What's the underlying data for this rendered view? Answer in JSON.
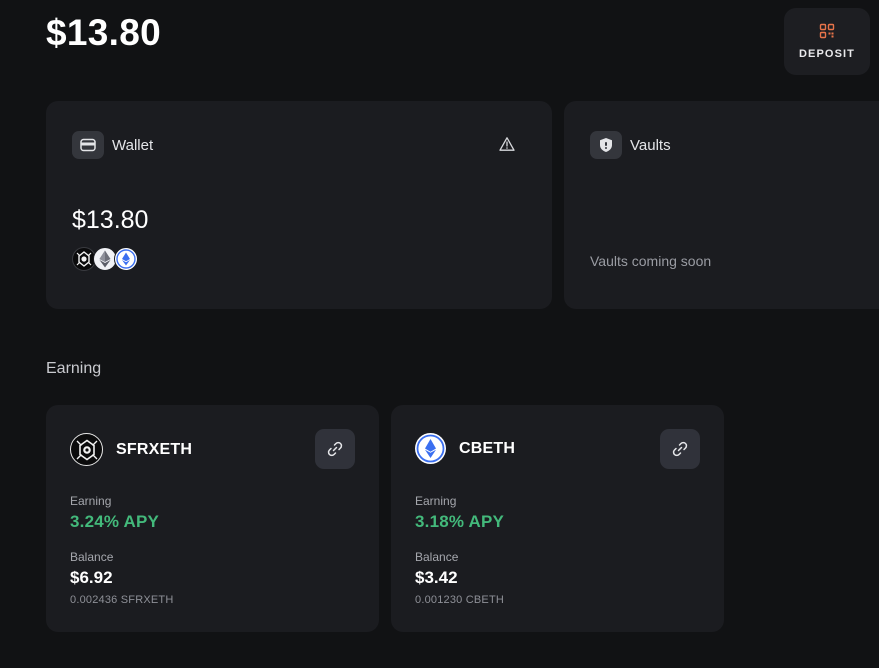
{
  "header": {
    "total_balance": "$13.80",
    "deposit_label": "DEPOSIT"
  },
  "wallet": {
    "label": "Wallet",
    "amount": "$13.80",
    "tokens": [
      "sfrxeth-logo",
      "eth-logo",
      "cbeth-logo"
    ]
  },
  "vaults": {
    "label": "Vaults",
    "message": "Vaults coming soon"
  },
  "earning": {
    "title": "Earning",
    "assets": [
      {
        "name": "SFRXETH",
        "icon": "sfrxeth-logo",
        "earning_label": "Earning",
        "apy": "3.24% APY",
        "balance_label": "Balance",
        "balance": "$6.92",
        "amount": "0.002436 SFRXETH"
      },
      {
        "name": "CBETH",
        "icon": "cbeth-logo",
        "earning_label": "Earning",
        "apy": "3.18% APY",
        "balance_label": "Balance",
        "balance": "$3.42",
        "amount": "0.001230 CBETH"
      }
    ]
  },
  "colors": {
    "background": "#111214",
    "card": "#1b1c20",
    "apy_green": "#43b97b",
    "deposit_icon": "#e8744a",
    "eth_blue": "#3b6ff0"
  }
}
